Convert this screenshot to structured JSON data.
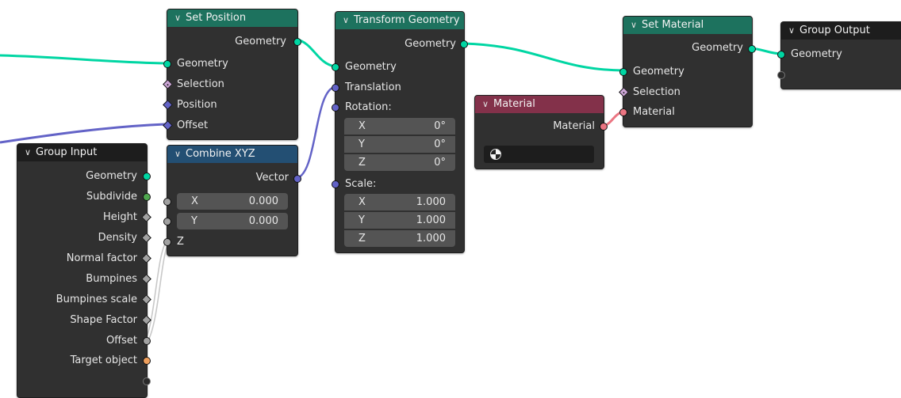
{
  "nodes": {
    "set_position": {
      "title": "Set Position",
      "out_geometry": "Geometry",
      "in_geometry": "Geometry",
      "in_selection": "Selection",
      "in_position": "Position",
      "in_offset": "Offset"
    },
    "transform_geometry": {
      "title": "Transform Geometry",
      "out_geometry": "Geometry",
      "in_geometry": "Geometry",
      "in_translation": "Translation",
      "in_rotation": "Rotation:",
      "rotation": [
        {
          "axis": "X",
          "value": "0°"
        },
        {
          "axis": "Y",
          "value": "0°"
        },
        {
          "axis": "Z",
          "value": "0°"
        }
      ],
      "in_scale": "Scale:",
      "scale": [
        {
          "axis": "X",
          "value": "1.000"
        },
        {
          "axis": "Y",
          "value": "1.000"
        },
        {
          "axis": "Z",
          "value": "1.000"
        }
      ]
    },
    "set_material": {
      "title": "Set Material",
      "out_geometry": "Geometry",
      "in_geometry": "Geometry",
      "in_selection": "Selection",
      "in_material": "Material"
    },
    "group_output": {
      "title": "Group Output",
      "in_geometry": "Geometry"
    },
    "material": {
      "title": "Material",
      "out_material": "Material",
      "value": ""
    },
    "combine_xyz": {
      "title": "Combine XYZ",
      "out_vector": "Vector",
      "x_label": "X",
      "x_value": "0.000",
      "y_label": "Y",
      "y_value": "0.000",
      "z_label": "Z"
    },
    "group_input": {
      "title": "Group Input",
      "outputs": [
        "Geometry",
        "Subdivide",
        "Height",
        "Density",
        "Normal factor",
        "Bumpines",
        "Bumpines scale",
        "Shape Factor",
        "Offset",
        "Target object"
      ]
    }
  },
  "colors": {
    "geometry_socket": "#00d6a3",
    "vector_socket": "#6363c7",
    "float_socket": "#a1a1a1",
    "int_socket": "#4fa74f",
    "object_socket": "#ed9e5c",
    "material_socket": "#eb7582",
    "bool_socket": "#cca6d6",
    "geometry_header": "#1d725e",
    "vector_header": "#234f73",
    "material_header": "#83314a",
    "group_header": "#1d1d1d",
    "node_body": "#303030"
  }
}
